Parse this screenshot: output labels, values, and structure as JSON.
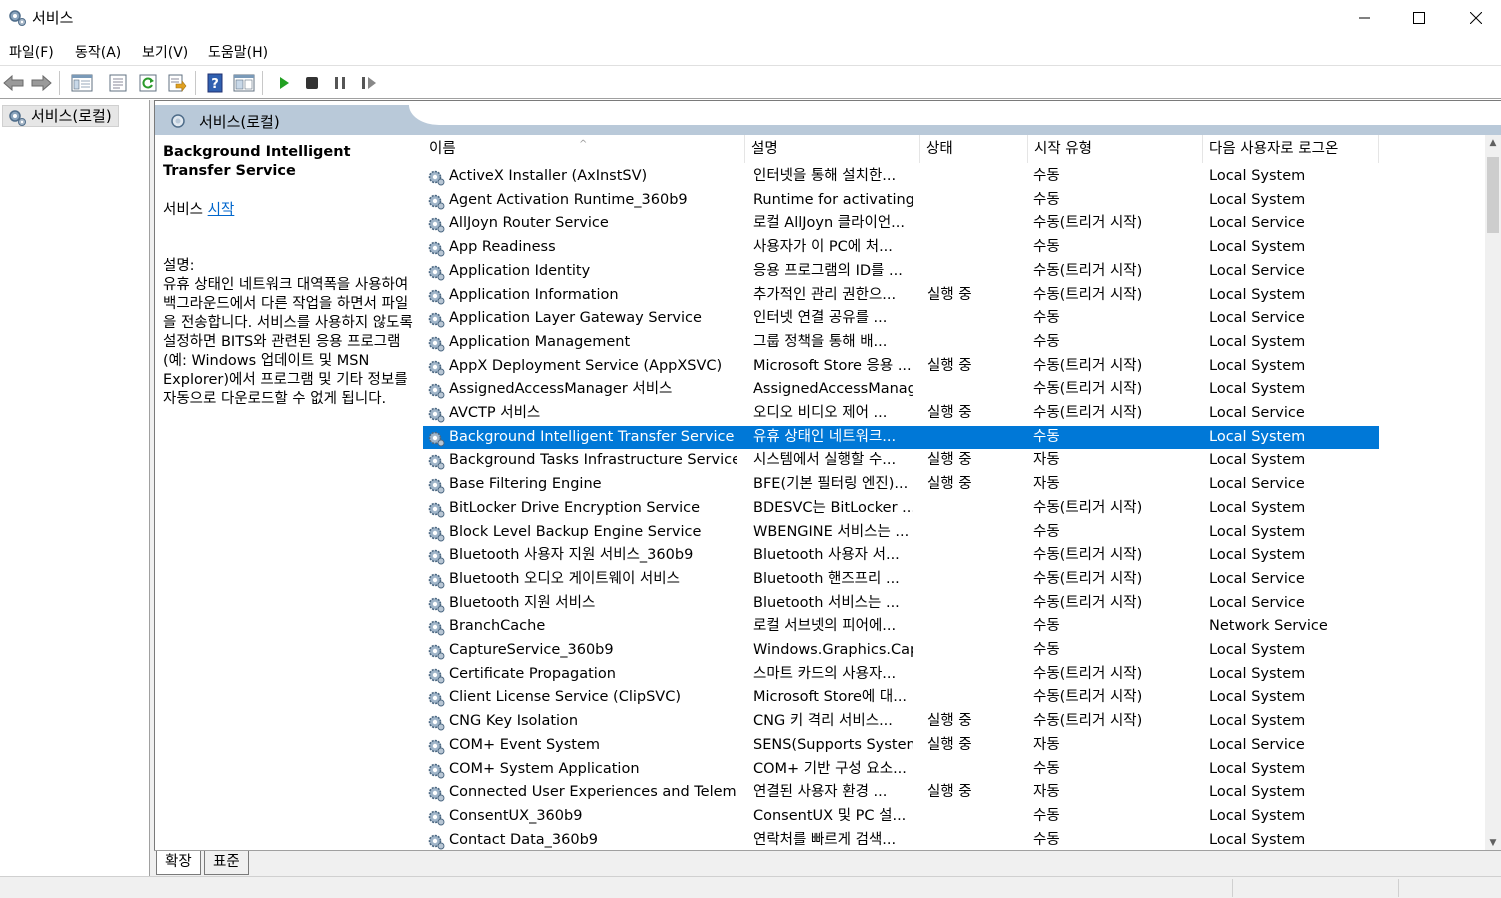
{
  "window": {
    "title": "서비스"
  },
  "menu": [
    "파일(F)",
    "동작(A)",
    "보기(V)",
    "도움말(H)"
  ],
  "toolbar": {
    "buttons": [
      "back-arrow-icon",
      "forward-arrow-icon",
      "show-tree-icon",
      "properties-icon",
      "refresh-icon",
      "export-icon",
      "help-icon",
      "console-view-icon",
      "play-icon",
      "stop-icon",
      "pause-icon",
      "restart-icon"
    ]
  },
  "tree": {
    "root_label": "서비스(로컬)"
  },
  "content": {
    "header_label": "서비스(로컬)",
    "selected_service": {
      "title": "Background Intelligent Transfer Service",
      "action_prefix": "서비스",
      "action_link": "시작",
      "desc_label": "설명:",
      "description": "유휴 상태인 네트워크 대역폭을 사용하여 백그라운드에서 다른 작업을 하면서 파일을 전송합니다. 서비스를 사용하지 않도록 설정하면 BITS와 관련된 응용 프로그램(예: Windows 업데이트 및 MSN Explorer)에서 프로그램 및 기타 정보를 자동으로 다운로드할 수 없게 됩니다."
    },
    "columns": [
      "이름",
      "설명",
      "상태",
      "시작 유형",
      "다음 사용자로 로그온"
    ],
    "rows": [
      [
        "ActiveX Installer (AxInstSV)",
        "인터넷을 통해 설치한...",
        "",
        "수동",
        "Local System"
      ],
      [
        "Agent Activation Runtime_360b9",
        "Runtime for activating...",
        "",
        "수동",
        "Local System"
      ],
      [
        "AllJoyn Router Service",
        "로컬 AllJoyn 클라이언...",
        "",
        "수동(트리거 시작)",
        "Local Service"
      ],
      [
        "App Readiness",
        "사용자가 이 PC에 처...",
        "",
        "수동",
        "Local System"
      ],
      [
        "Application Identity",
        "응용 프로그램의 ID를 ...",
        "",
        "수동(트리거 시작)",
        "Local Service"
      ],
      [
        "Application Information",
        "추가적인 관리 권한으...",
        "실행 중",
        "수동(트리거 시작)",
        "Local System"
      ],
      [
        "Application Layer Gateway Service",
        "인터넷 연결 공유를 ...",
        "",
        "수동",
        "Local Service"
      ],
      [
        "Application Management",
        "그룹 정책을 통해 배...",
        "",
        "수동",
        "Local System"
      ],
      [
        "AppX Deployment Service (AppXSVC)",
        "Microsoft Store 응용 ...",
        "실행 중",
        "수동(트리거 시작)",
        "Local System"
      ],
      [
        "AssignedAccessManager 서비스",
        "AssignedAccessManag...",
        "",
        "수동(트리거 시작)",
        "Local System"
      ],
      [
        "AVCTP 서비스",
        "오디오 비디오 제어 ...",
        "실행 중",
        "수동(트리거 시작)",
        "Local Service"
      ],
      [
        "Background Intelligent Transfer Service",
        "유휴 상태인 네트워크...",
        "",
        "수동",
        "Local System"
      ],
      [
        "Background Tasks Infrastructure Service",
        "시스템에서 실행할 수...",
        "실행 중",
        "자동",
        "Local System"
      ],
      [
        "Base Filtering Engine",
        "BFE(기본 필터링 엔진)...",
        "실행 중",
        "자동",
        "Local Service"
      ],
      [
        "BitLocker Drive Encryption Service",
        "BDESVC는 BitLocker ...",
        "",
        "수동(트리거 시작)",
        "Local System"
      ],
      [
        "Block Level Backup Engine Service",
        "WBENGINE 서비스는 ...",
        "",
        "수동",
        "Local System"
      ],
      [
        "Bluetooth 사용자 지원 서비스_360b9",
        "Bluetooth 사용자 서...",
        "",
        "수동(트리거 시작)",
        "Local System"
      ],
      [
        "Bluetooth 오디오 게이트웨이 서비스",
        "Bluetooth 핸즈프리 ...",
        "",
        "수동(트리거 시작)",
        "Local Service"
      ],
      [
        "Bluetooth 지원 서비스",
        "Bluetooth 서비스는 ...",
        "",
        "수동(트리거 시작)",
        "Local Service"
      ],
      [
        "BranchCache",
        "로컬 서브넷의 피어에...",
        "",
        "수동",
        "Network Service"
      ],
      [
        "CaptureService_360b9",
        "Windows.Graphics.Cap...",
        "",
        "수동",
        "Local System"
      ],
      [
        "Certificate Propagation",
        "스마트 카드의 사용자...",
        "",
        "수동(트리거 시작)",
        "Local System"
      ],
      [
        "Client License Service (ClipSVC)",
        "Microsoft Store에 대...",
        "",
        "수동(트리거 시작)",
        "Local System"
      ],
      [
        "CNG Key Isolation",
        "CNG 키 격리 서비스...",
        "실행 중",
        "수동(트리거 시작)",
        "Local System"
      ],
      [
        "COM+ Event System",
        "SENS(Supports System...",
        "실행 중",
        "자동",
        "Local Service"
      ],
      [
        "COM+ System Application",
        "COM+ 기반 구성 요소...",
        "",
        "수동",
        "Local System"
      ],
      [
        "Connected User Experiences and Telemetry",
        "연결된 사용자 환경 ...",
        "실행 중",
        "자동",
        "Local System"
      ],
      [
        "ConsentUX_360b9",
        "ConsentUX 및 PC 설...",
        "",
        "수동",
        "Local System"
      ],
      [
        "Contact Data_360b9",
        "연락처를 빠르게 검색...",
        "",
        "수동",
        "Local System"
      ]
    ],
    "selected_index": 11
  },
  "tabs": [
    "확장",
    "표준"
  ],
  "colors": {
    "selection": "#0078d7",
    "header": "#b9c9d9",
    "link": "#0066cc"
  }
}
